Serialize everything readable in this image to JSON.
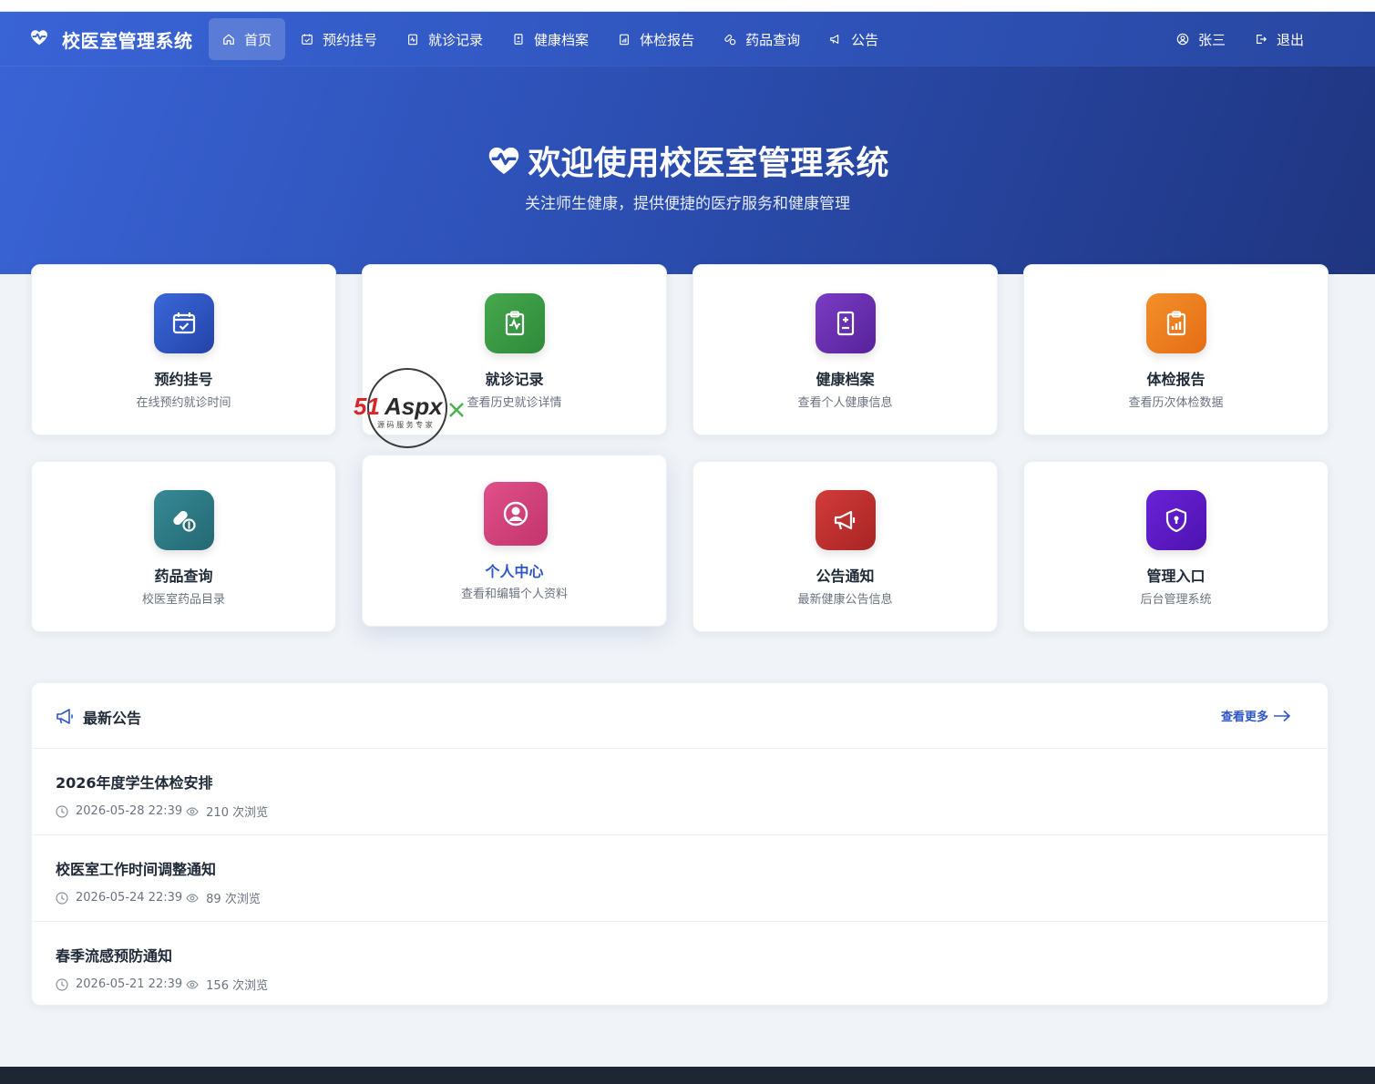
{
  "brand": {
    "title": "校医室管理系统",
    "icon": "heart-pulse-icon"
  },
  "nav": {
    "items": [
      {
        "label": "首页",
        "icon": "home-icon",
        "active": true
      },
      {
        "label": "预约挂号",
        "icon": "calendar-check-icon"
      },
      {
        "label": "就诊记录",
        "icon": "clipboard-pulse-icon"
      },
      {
        "label": "健康档案",
        "icon": "file-medical-icon"
      },
      {
        "label": "体检报告",
        "icon": "clipboard-chart-icon"
      },
      {
        "label": "药品查询",
        "icon": "capsule-icon"
      },
      {
        "label": "公告",
        "icon": "megaphone-icon"
      }
    ],
    "user": {
      "label": "张三",
      "icon": "user-circle-icon"
    },
    "logout": {
      "label": "退出",
      "icon": "logout-icon"
    }
  },
  "hero": {
    "title": "欢迎使用校医室管理系统",
    "subtitle": "关注师生健康，提供便捷的医疗服务和健康管理"
  },
  "cards": [
    {
      "title": "预约挂号",
      "desc": "在线预约就诊时间",
      "icon": "calendar-check-icon",
      "color": "#2f56c6"
    },
    {
      "title": "就诊记录",
      "desc": "查看历史就诊详情",
      "icon": "clipboard-pulse-icon",
      "color": "#3a9a44"
    },
    {
      "title": "健康档案",
      "desc": "查看个人健康信息",
      "icon": "file-medical-icon",
      "color": "#6a2fb0"
    },
    {
      "title": "体检报告",
      "desc": "查看历次体检数据",
      "icon": "clipboard-chart-icon",
      "color": "#ee7b1c"
    },
    {
      "title": "药品查询",
      "desc": "校医室药品目录",
      "icon": "capsule-icon",
      "color": "#2d7b86"
    },
    {
      "title": "个人中心",
      "desc": "查看和编辑个人资料",
      "icon": "user-circle-icon",
      "color": "#d43f79"
    },
    {
      "title": "公告通知",
      "desc": "最新健康公告信息",
      "icon": "megaphone-icon",
      "color": "#c4302f"
    },
    {
      "title": "管理入口",
      "desc": "后台管理系统",
      "icon": "shield-icon",
      "color": "#5b18c9"
    }
  ],
  "watermark": {
    "brand": "51Aspx",
    "tagline": "源码服务专家"
  },
  "announcements": {
    "title": "最新公告",
    "more_label": "查看更多",
    "items": [
      {
        "title": "2026年度学生体检安排",
        "date": "2026-05-28 22:39",
        "views": "210 次浏览"
      },
      {
        "title": "校医室工作时间调整通知",
        "date": "2026-05-24 22:39",
        "views": "89 次浏览"
      },
      {
        "title": "春季流感预防通知",
        "date": "2026-05-21 22:39",
        "views": "156 次浏览"
      }
    ]
  }
}
